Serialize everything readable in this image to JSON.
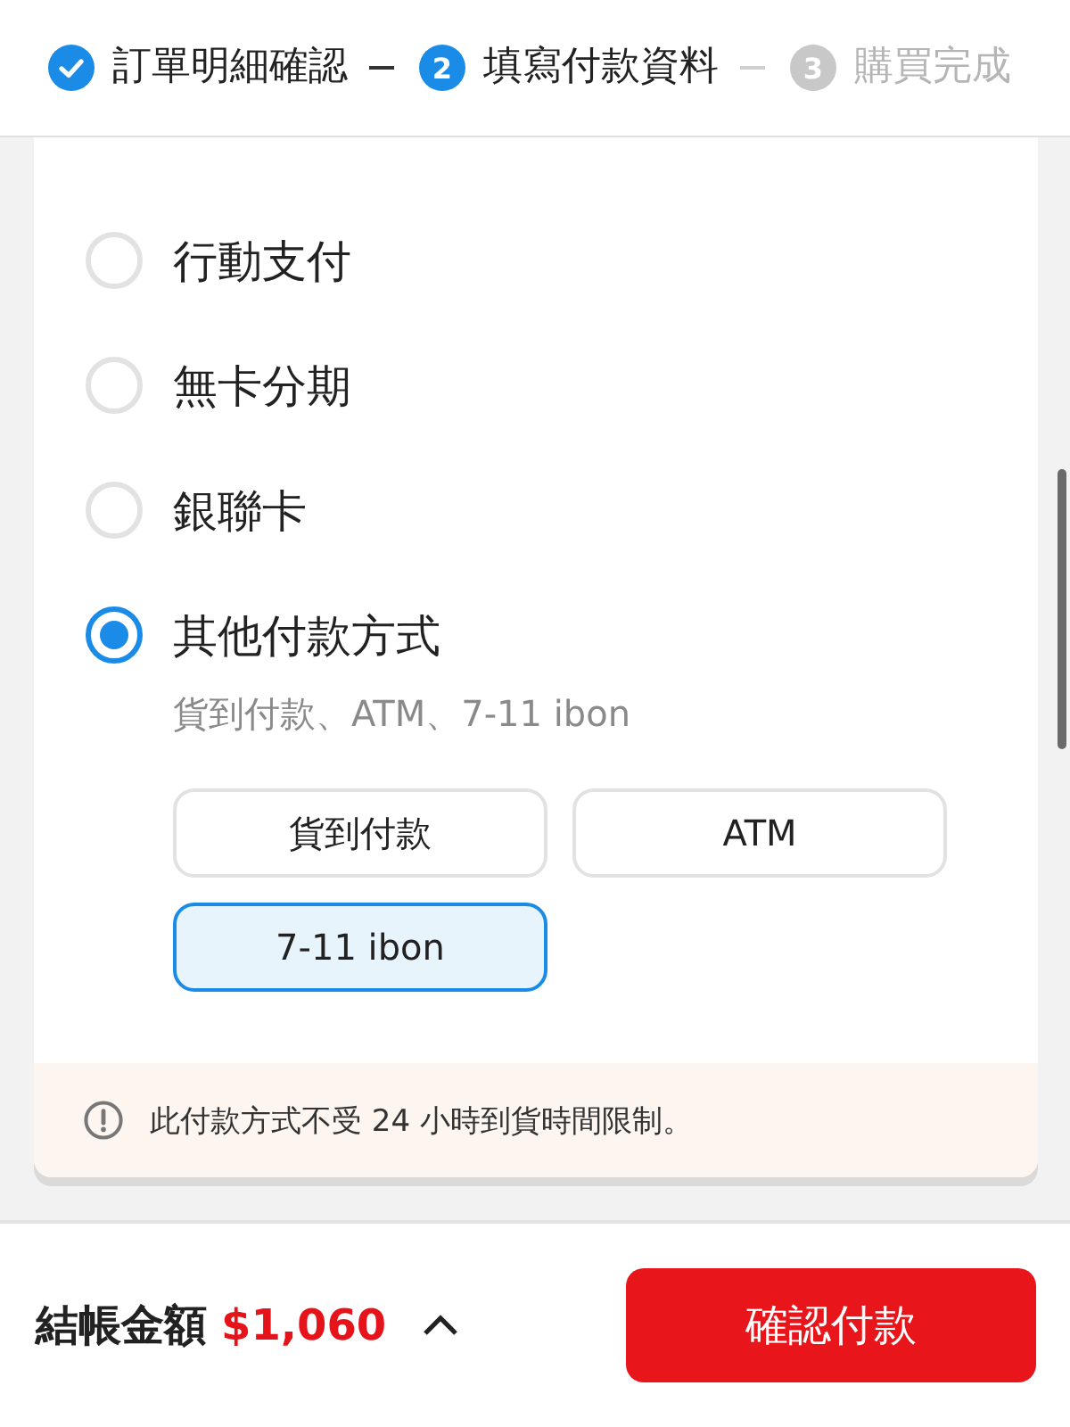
{
  "progress_steps": [
    {
      "label": "訂單明細確認",
      "completed": true,
      "active": true
    },
    {
      "number": "2",
      "label": "填寫付款資料",
      "completed": false,
      "active": true
    },
    {
      "number": "3",
      "label": "購買完成",
      "completed": false,
      "active": false
    }
  ],
  "payment_methods": [
    {
      "label": "行動支付",
      "selected": false
    },
    {
      "label": "無卡分期",
      "selected": false
    },
    {
      "label": "銀聯卡",
      "selected": false
    },
    {
      "label": "其他付款方式",
      "selected": true,
      "description": "貨到付款、ATM、7-11 ibon",
      "options": [
        {
          "label": "貨到付款",
          "selected": false
        },
        {
          "label": "ATM",
          "selected": false
        },
        {
          "label": "7-11 ibon",
          "selected": true
        }
      ]
    }
  ],
  "notice": {
    "text": "此付款方式不受 24 小時到貨時間限制。"
  },
  "footer": {
    "total_label": "結帳金額",
    "total_amount": "$1,060",
    "confirm_button": "確認付款"
  }
}
